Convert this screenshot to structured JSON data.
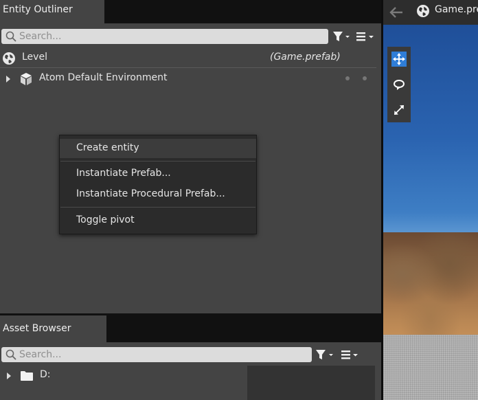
{
  "outliner": {
    "tab_label": "Entity Outliner",
    "search_placeholder": "Search...",
    "rows": [
      {
        "label": "Level",
        "suffix": "(Game.prefab)",
        "icon": "globe-icon"
      },
      {
        "label": "Atom Default Environment",
        "icon": "cube-icon",
        "expand": "caret-right-icon"
      }
    ]
  },
  "context_menu": {
    "items": [
      {
        "label": "Create entity"
      },
      {
        "label": "Instantiate Prefab..."
      },
      {
        "label": "Instantiate Procedural Prefab..."
      },
      {
        "label": "Toggle pivot"
      }
    ]
  },
  "assets": {
    "tab_label": "Asset Browser",
    "search_placeholder": "Search...",
    "tree": [
      {
        "label": "D:",
        "icon": "folder-icon",
        "expand": "caret-right-icon"
      }
    ]
  },
  "viewport": {
    "title": "Game.prefab",
    "tools": [
      "move-icon",
      "rotate-icon",
      "scale-icon"
    ],
    "active_tool": "move-icon"
  },
  "colors": {
    "panel_bg": "#444444",
    "header_bg": "#111111",
    "menu_bg": "#2b2b2b",
    "active_tool": "#2f7dd6"
  }
}
